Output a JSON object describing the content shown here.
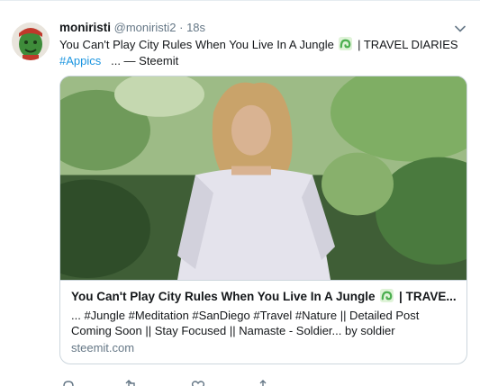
{
  "tweet": {
    "display_name": "moniristi",
    "screen_name": "@moniristi2",
    "separator": "·",
    "timestamp": "18s",
    "text_line1": "You Can't Play City Rules When You Live In A Jungle",
    "text_line1_suffix": "| TRAVEL DIARIES",
    "hashtag": "#Appics",
    "text_line2_suffix": "... — Steemit"
  },
  "card": {
    "title": "You Can't Play City Rules When You Live In A Jungle",
    "title_suffix": "| TRAVE...",
    "description_line1": "... #Jungle #Meditation #SanDiego #Travel #Nature || Detailed Post",
    "description_line2": "Coming Soon || Stay Focused || Namaste - Soldier... by soldier",
    "domain": "steemit.com"
  },
  "icons": {
    "avatar": "avatar-image",
    "menu": "chevron-down-icon",
    "emoji": "green-snake-emoji",
    "reply": "reply-icon",
    "retweet": "retweet-icon",
    "like": "heart-icon",
    "share": "share-icon"
  },
  "colors": {
    "link": "#1b95e0",
    "secondary_text": "#657786",
    "card_border": "#ccd6dd"
  }
}
